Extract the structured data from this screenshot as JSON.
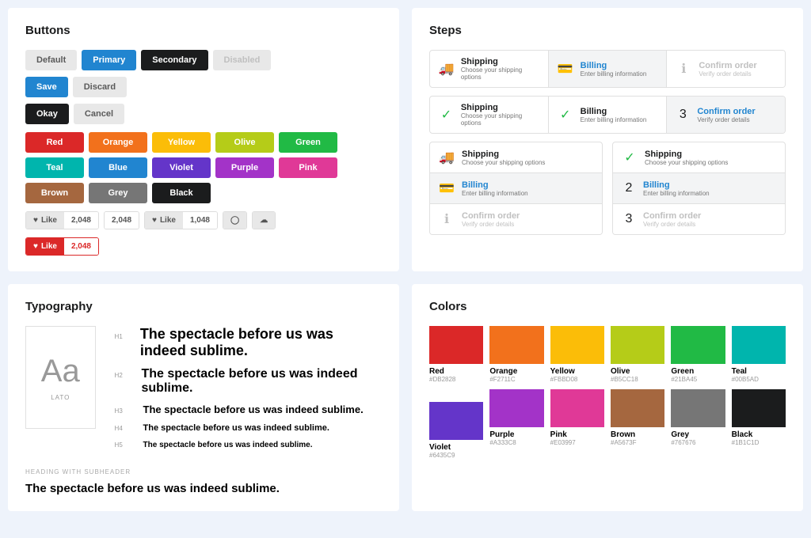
{
  "buttons": {
    "title": "Buttons",
    "row1": [
      "Default",
      "Primary",
      "Secondary",
      "Disabled"
    ],
    "row2a": [
      "Save",
      "Discard"
    ],
    "row2b": [
      "Okay",
      "Cancel"
    ],
    "colors": [
      "Red",
      "Orange",
      "Yellow",
      "Olive",
      "Green",
      "Teal",
      "Blue",
      "Violet",
      "Purple",
      "Pink",
      "Brown",
      "Grey",
      "Black"
    ],
    "labels": {
      "like": "Like",
      "counts": [
        "2,048",
        "2,048",
        "1,048",
        "2,048"
      ],
      "redCount": "2,048"
    }
  },
  "steps": {
    "title": "Steps",
    "items": {
      "shipping": {
        "t": "Shipping",
        "d": "Choose your shipping options"
      },
      "billing": {
        "t": "Billing",
        "d": "Enter billing information"
      },
      "confirm": {
        "t": "Confirm order",
        "d": "Verify order details"
      }
    },
    "nums": {
      "two": "2",
      "three": "3"
    }
  },
  "typo": {
    "title": "Typography",
    "fontSample": "Aa",
    "fontName": "LATO",
    "sentence": "The spectacle before us was indeed sublime.",
    "tags": [
      "H1",
      "H2",
      "H3",
      "H4",
      "H5"
    ],
    "subheaderLabel": "HEADING WITH SUBHEADER"
  },
  "colors": {
    "title": "Colors",
    "items": [
      {
        "n": "Red",
        "h": "#DB2828",
        "c": "c-red"
      },
      {
        "n": "Orange",
        "h": "#F2711C",
        "c": "c-orange"
      },
      {
        "n": "Yellow",
        "h": "#FBBD08",
        "c": "c-yellow"
      },
      {
        "n": "Olive",
        "h": "#B5CC18",
        "c": "c-olive"
      },
      {
        "n": "Green",
        "h": "#21BA45",
        "c": "c-green"
      },
      {
        "n": "Teal",
        "h": "#00B5AD",
        "c": "c-teal"
      },
      {
        "n": "Violet",
        "h": "#6435C9",
        "c": "c-violet"
      },
      {
        "n": "Purple",
        "h": "#A333C8",
        "c": "c-purple"
      },
      {
        "n": "Pink",
        "h": "#E03997",
        "c": "c-pink"
      },
      {
        "n": "Brown",
        "h": "#A5673F",
        "c": "c-brown"
      },
      {
        "n": "Grey",
        "h": "#767676",
        "c": "c-grey"
      },
      {
        "n": "Black",
        "h": "#1B1C1D",
        "c": "c-black"
      }
    ]
  }
}
